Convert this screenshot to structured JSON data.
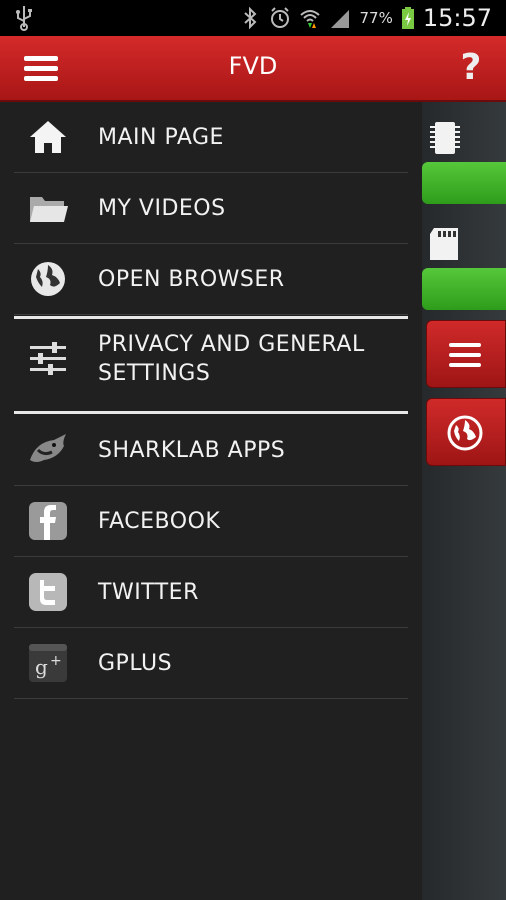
{
  "status_bar": {
    "battery": "77%",
    "time": "15:57"
  },
  "app_bar": {
    "title": "FVD",
    "help": "?"
  },
  "drawer": {
    "items": [
      {
        "label": "MAIN PAGE",
        "icon": "home-icon"
      },
      {
        "label": "MY VIDEOS",
        "icon": "folder-icon"
      },
      {
        "label": "OPEN BROWSER",
        "icon": "globe-icon"
      },
      {
        "label": "PRIVACY AND GENERAL SETTINGS",
        "icon": "sliders-icon"
      },
      {
        "label": "SHARKLAB APPS",
        "icon": "sharklab-icon"
      },
      {
        "label": "FACEBOOK",
        "icon": "facebook-icon"
      },
      {
        "label": "TWITTER",
        "icon": "twitter-icon"
      },
      {
        "label": "GPLUS",
        "icon": "gplus-icon"
      }
    ]
  },
  "colors": {
    "accent_red": "#c41f1f",
    "green": "#3fb22a",
    "drawer_bg": "#202020"
  }
}
